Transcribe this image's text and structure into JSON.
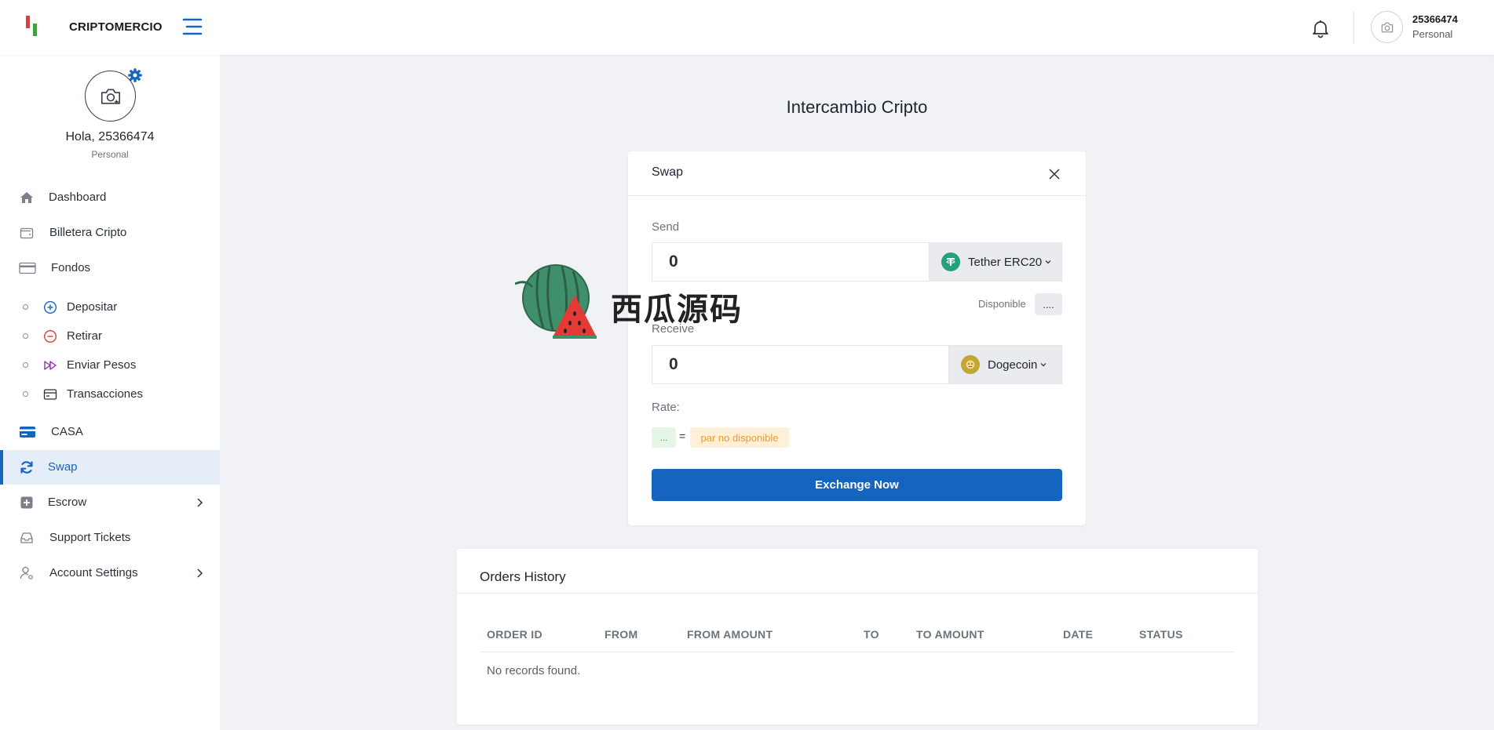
{
  "header": {
    "brand": "CRIPTOMERCIO",
    "user_name": "25366474",
    "user_role": "Personal"
  },
  "sidebar": {
    "greeting": "Hola, 25366474",
    "role": "Personal",
    "items": [
      {
        "label": "Dashboard",
        "icon": "home-icon"
      },
      {
        "label": "Billetera Cripto",
        "icon": "wallet-icon"
      },
      {
        "label": "Fondos",
        "icon": "credit-card-icon"
      },
      {
        "label": "Depositar",
        "icon": "plus-circle-icon"
      },
      {
        "label": "Retirar",
        "icon": "minus-circle-icon"
      },
      {
        "label": "Enviar Pesos",
        "icon": "fast-forward-icon"
      },
      {
        "label": "Transacciones",
        "icon": "card-list-icon"
      },
      {
        "label": "CASA",
        "icon": "casa-card-icon"
      },
      {
        "label": "Swap",
        "icon": "refresh-icon",
        "active": true
      },
      {
        "label": "Escrow",
        "icon": "plus-square-icon"
      },
      {
        "label": "Support Tickets",
        "icon": "inbox-icon"
      },
      {
        "label": "Account Settings",
        "icon": "user-settings-icon"
      }
    ]
  },
  "main": {
    "title": "Intercambio Cripto"
  },
  "swap": {
    "title": "Swap",
    "send_label": "Send",
    "send_value": "0",
    "send_coin": "Tether ERC20",
    "available_label": "Disponible",
    "available_value": "....",
    "receive_label": "Receive",
    "receive_value": "0",
    "receive_coin": "Dogecoin",
    "rate_label": "Rate:",
    "rate_left": "...",
    "rate_eq": "=",
    "rate_right": "par no disponible",
    "exchange_button": "Exchange Now"
  },
  "orders": {
    "title": "Orders History",
    "columns": [
      "ORDER ID",
      "FROM",
      "FROM AMOUNT",
      "TO",
      "TO AMOUNT",
      "DATE",
      "STATUS"
    ],
    "empty_text": "No records found."
  },
  "watermark": {
    "text": "西瓜源码"
  },
  "colors": {
    "accent": "#1565c0",
    "tether": "#26a17b",
    "dogecoin": "#c2a633",
    "active_bg": "#e4edf8"
  }
}
